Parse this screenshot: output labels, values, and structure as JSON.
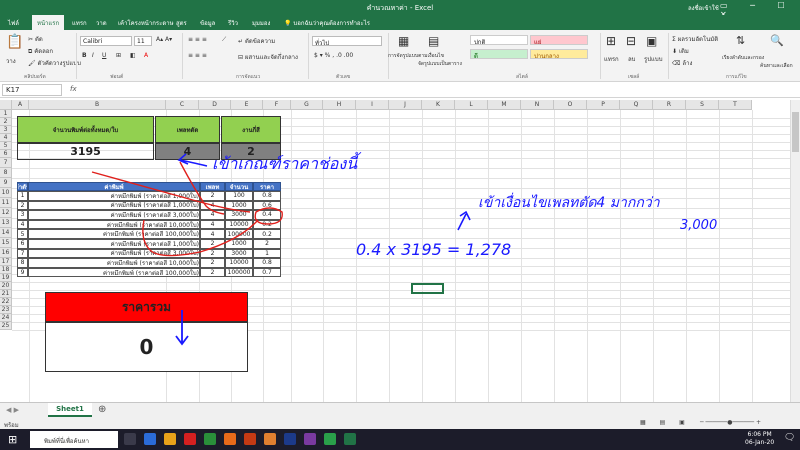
{
  "window": {
    "title": "คำนวณหาค่า - Excel",
    "signin": "ลงชื่อเข้าใช้",
    "tell_me": "บอกฉันว่าคุณต้องการทำอะไร"
  },
  "tabs": [
    "ไฟล์",
    "หน้าแรก",
    "แทรก",
    "วาด",
    "เค้าโครงหน้ากระดาษ",
    "สูตร",
    "ข้อมูล",
    "รีวิว",
    "มุมมอง"
  ],
  "ribbon": {
    "paste": "วาง",
    "cut": "ตัด",
    "copy": "คัดลอก",
    "format_painter": "ตัวคัดวางรูปแบบ",
    "font_name": "Calibri",
    "font_size": "11",
    "wrap": "ตัดข้อความ",
    "merge": "ผสานและจัดกึ่งกลาง",
    "number_format": "ทั่วไป",
    "cond_format": "การจัดรูปแบบตามเงื่อนไข",
    "format_table": "จัดรูปแบบเป็นตาราง",
    "style_normal": "ปกติ",
    "style_bad": "แย่",
    "style_good": "ดี",
    "style_neutral": "ปานกลาง",
    "insert": "แทรก",
    "delete": "ลบ",
    "format": "รูปแบบ",
    "autosum": "ผลรวมอัตโนมัติ",
    "fill": "เติม",
    "clear": "ล้าง",
    "sort_filter": "เรียงลำดับและกรอง",
    "find_select": "ค้นหาและเลือก",
    "groups": {
      "clipboard": "คลิปบอร์ด",
      "font": "ฟอนต์",
      "alignment": "การจัดแนว",
      "number": "ตัวเลข",
      "styles": "สไตล์",
      "cells": "เซลล์",
      "editing": "การแก้ไข"
    }
  },
  "formula_bar": {
    "name_box": "K17",
    "fx": "fx"
  },
  "columns": [
    "A",
    "B",
    "C",
    "D",
    "E",
    "F",
    "G",
    "H",
    "I",
    "J",
    "K",
    "L",
    "M",
    "N",
    "O",
    "P",
    "Q",
    "R",
    "S",
    "T"
  ],
  "rows": [
    "1",
    "2",
    "3",
    "4",
    "5",
    "6",
    "7",
    "8",
    "9",
    "10",
    "11",
    "12",
    "13",
    "14",
    "15",
    "16",
    "17",
    "18",
    "19",
    "20",
    "21",
    "22",
    "23",
    "24",
    "25"
  ],
  "sheet": {
    "h_qty": "จำนวนพิมพ์ต่อทั้งหมด/ใบ",
    "h_plate": "เพลทตัด",
    "h_days": "งานกี่สี",
    "qty": "3195",
    "plate": "4",
    "days": "2",
    "th": [
      "ลำดับ",
      "ค่าพิมพ์",
      "เพลท",
      "จำนวน",
      "ราคา"
    ],
    "table": [
      [
        "1",
        "ค่าหมึกพิมพ์ (ราคาต่อสี 1,000ใบ)",
        "2",
        "100",
        "0.8"
      ],
      [
        "2",
        "ค่าหมึกพิมพ์ (ราคาต่อสี 1,000ใบ)",
        "4",
        "1000",
        "0.6"
      ],
      [
        "3",
        "ค่าหมึกพิมพ์ (ราคาต่อสี 3,000ใบ)",
        "4",
        "3000",
        "0.4"
      ],
      [
        "4",
        "ค่าหมึกพิมพ์ (ราคาต่อสี 10,000ใบ)",
        "4",
        "10000",
        "0.2"
      ],
      [
        "5",
        "ค่าหมึกพิมพ์ (ราคาต่อสี 100,000ใบ)",
        "4",
        "100000",
        "0.2"
      ],
      [
        "6",
        "ค่าหมึกพิมพ์ (ราคาต่อสี 1,000ใบ)",
        "2",
        "1000",
        "2"
      ],
      [
        "7",
        "ค่าหมึกพิมพ์ (ราคาต่อสี 3,000ใบ)",
        "2",
        "3000",
        "1"
      ],
      [
        "8",
        "ค่าหมึกพิมพ์ (ราคาต่อสี 10,000ใบ)",
        "2",
        "10000",
        "0.8"
      ],
      [
        "9",
        "ค่าหมึกพิมพ์ (ราคาต่อสี 100,000ใบ)",
        "2",
        "100000",
        "0.7"
      ]
    ],
    "total_label": "ราคารวม",
    "total_value": "0"
  },
  "annotations": {
    "note1": "เข้าเกณฑ์ราคาช่องนี้",
    "note2": "เข้าเงื่อนไขเพลทตัด4 มากกว่า",
    "note3": "3,000",
    "formula": "0.4 x 3195 = 1,278"
  },
  "sheet_tab": "Sheet1",
  "status": "พร้อม",
  "taskbar": {
    "search": "พิมพ์ที่นี่เพื่อค้นหา",
    "time": "6:06 PM",
    "date": "06-Jan-20"
  },
  "colors": {
    "excel_green": "#217346",
    "header_green": "#92d050",
    "table_blue": "#4472c4",
    "total_red": "#ff0000",
    "ink": "#1a1aff",
    "ink_red": "#e0201c"
  }
}
